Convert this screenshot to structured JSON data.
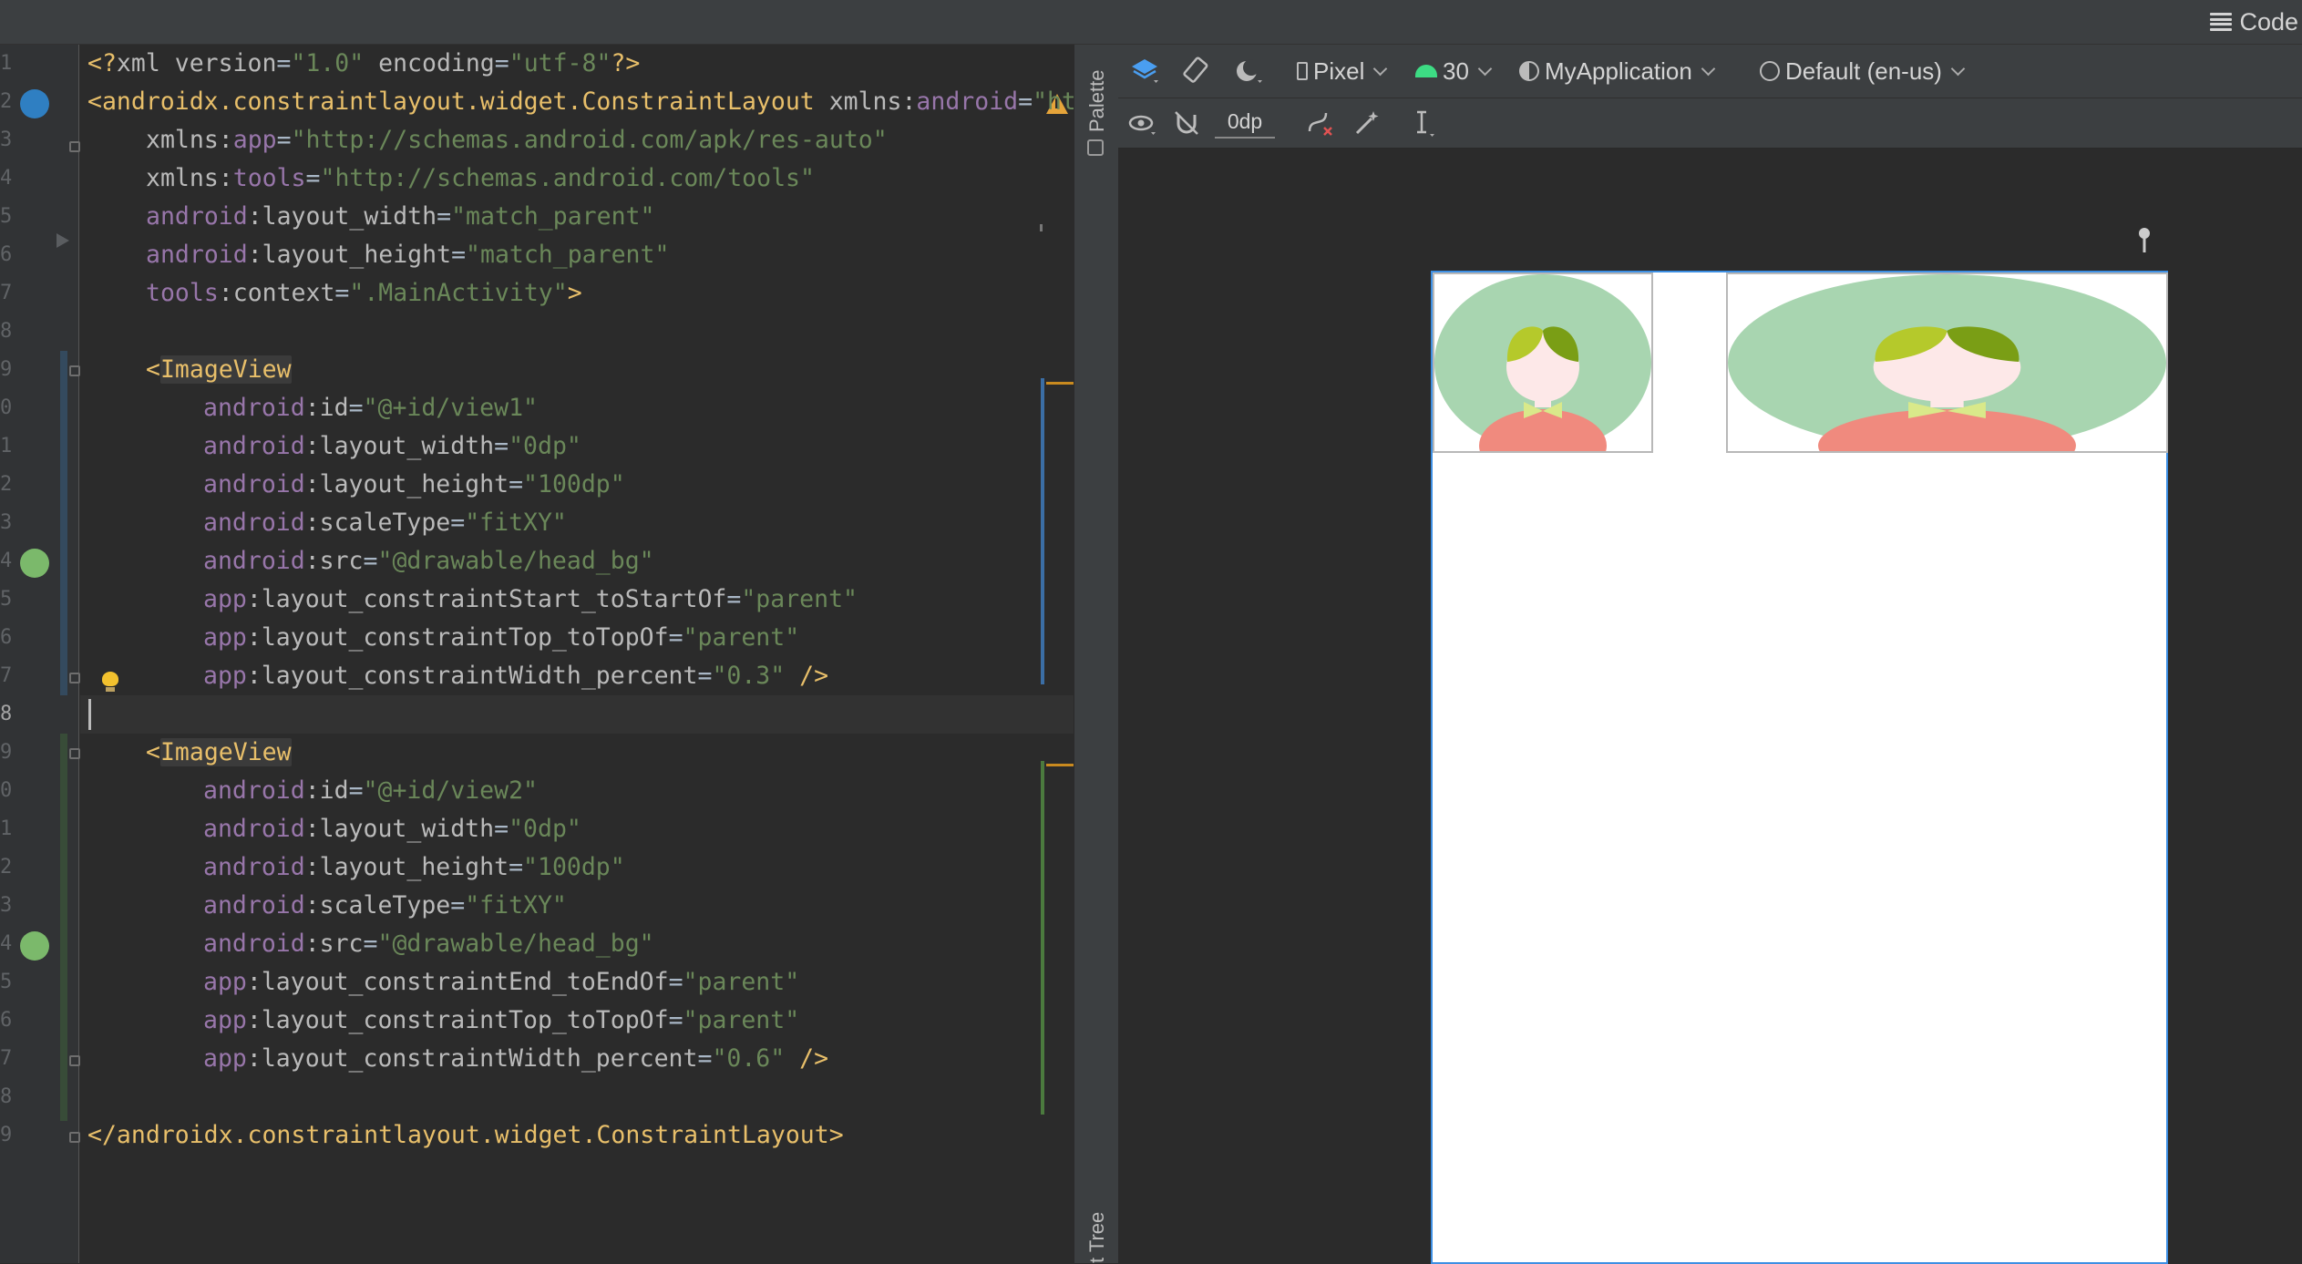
{
  "topbar": {
    "mode_label": "Code",
    "mode_icon": "menu-lines-icon"
  },
  "editor": {
    "lines": [
      {
        "n": "1"
      },
      {
        "n": "2"
      },
      {
        "n": "3"
      },
      {
        "n": "4"
      },
      {
        "n": "5"
      },
      {
        "n": "6"
      },
      {
        "n": "7"
      },
      {
        "n": "8"
      },
      {
        "n": "9"
      },
      {
        "n": "0"
      },
      {
        "n": "1"
      },
      {
        "n": "2"
      },
      {
        "n": "3"
      },
      {
        "n": "4"
      },
      {
        "n": "5"
      },
      {
        "n": "6"
      },
      {
        "n": "7"
      },
      {
        "n": "8"
      },
      {
        "n": "9"
      },
      {
        "n": "0"
      },
      {
        "n": "1"
      },
      {
        "n": "2"
      },
      {
        "n": "3"
      },
      {
        "n": "4"
      },
      {
        "n": "5"
      },
      {
        "n": "6"
      },
      {
        "n": "7"
      },
      {
        "n": "8"
      },
      {
        "n": "9"
      }
    ],
    "t": {
      "l1_a": "<?",
      "l1_b": "xml version",
      "l1_c": "=",
      "l1_d": "\"1.0\"",
      "l1_e": " encoding",
      "l1_f": "=",
      "l1_g": "\"utf-8\"",
      "l1_h": "?>",
      "l2_a": "<",
      "l2_b": "androidx.constraintlayout.widget.ConstraintLayout",
      "l2_c": " xmlns:",
      "l2_d": "android",
      "l2_e": "=",
      "l2_f": "\"ht",
      "l3_a": "xmlns:",
      "l3_b": "app",
      "l3_c": "=",
      "l3_d": "\"http://schemas.android.com/apk/res-auto\"",
      "l4_a": "xmlns:",
      "l4_b": "tools",
      "l4_c": "=",
      "l4_d": "\"http://schemas.android.com/tools\"",
      "l5_a": "android",
      "l5_b": ":layout_width",
      "l5_c": "=",
      "l5_d": "\"match_parent\"",
      "l6_a": "android",
      "l6_b": ":layout_height",
      "l6_c": "=",
      "l6_d": "\"match_parent\"",
      "l7_a": "tools",
      "l7_b": ":context",
      "l7_c": "=",
      "l7_d": "\".MainActivity\"",
      "l7_e": ">",
      "l9_a": "<",
      "l9_b": "ImageView",
      "l10_a": "android",
      "l10_b": ":id",
      "l10_c": "=",
      "l10_d": "\"@+id/view1\"",
      "l11_a": "android",
      "l11_b": ":layout_width",
      "l11_c": "=",
      "l11_d": "\"0dp\"",
      "l12_a": "android",
      "l12_b": ":layout_height",
      "l12_c": "=",
      "l12_d": "\"100dp\"",
      "l13_a": "android",
      "l13_b": ":scaleType",
      "l13_c": "=",
      "l13_d": "\"fitXY\"",
      "l14_a": "android",
      "l14_b": ":src",
      "l14_c": "=",
      "l14_d": "\"@drawable/head_bg\"",
      "l15_a": "app",
      "l15_b": ":layout_constraintStart_toStartOf",
      "l15_c": "=",
      "l15_d": "\"parent\"",
      "l16_a": "app",
      "l16_b": ":layout_constraintTop_toTopOf",
      "l16_c": "=",
      "l16_d": "\"parent\"",
      "l17_a": "app",
      "l17_b": ":layout_constraintWidth_percent",
      "l17_c": "=",
      "l17_d": "\"0.3\"",
      "l17_e": " />",
      "l19_a": "<",
      "l19_b": "ImageView",
      "l20_a": "android",
      "l20_b": ":id",
      "l20_c": "=",
      "l20_d": "\"@+id/view2\"",
      "l21_a": "android",
      "l21_b": ":layout_width",
      "l21_c": "=",
      "l21_d": "\"0dp\"",
      "l22_a": "android",
      "l22_b": ":layout_height",
      "l22_c": "=",
      "l22_d": "\"100dp\"",
      "l23_a": "android",
      "l23_b": ":scaleType",
      "l23_c": "=",
      "l23_d": "\"fitXY\"",
      "l24_a": "android",
      "l24_b": ":src",
      "l24_c": "=",
      "l24_d": "\"@drawable/head_bg\"",
      "l25_a": "app",
      "l25_b": ":layout_constraintEnd_toEndOf",
      "l25_c": "=",
      "l25_d": "\"parent\"",
      "l26_a": "app",
      "l26_b": ":layout_constraintTop_toTopOf",
      "l26_c": "=",
      "l26_d": "\"parent\"",
      "l27_a": "app",
      "l27_b": ":layout_constraintWidth_percent",
      "l27_c": "=",
      "l27_d": "\"0.6\"",
      "l27_e": " />",
      "l29_a": "</",
      "l29_b": "androidx.constraintlayout.widget.ConstraintLayout",
      "l29_c": ">"
    }
  },
  "rail": {
    "palette_label": "Palette",
    "tree_label": "t Tree"
  },
  "design_toolbar": {
    "device": "Pixel",
    "api_level": "30",
    "theme": "MyApplication",
    "locale": "Default (en-us)",
    "margin": "0dp"
  },
  "colors": {
    "accent": "#3d8fe3",
    "avatar_bg": "#a8d5b0",
    "avatar_hair_light": "#b5c92b",
    "avatar_hair_dark": "#7a9e15",
    "avatar_face": "#fde8e8",
    "avatar_shirt": "#f08a7e",
    "avatar_bow": "#d9e98a",
    "warning": "#e5a43a"
  }
}
